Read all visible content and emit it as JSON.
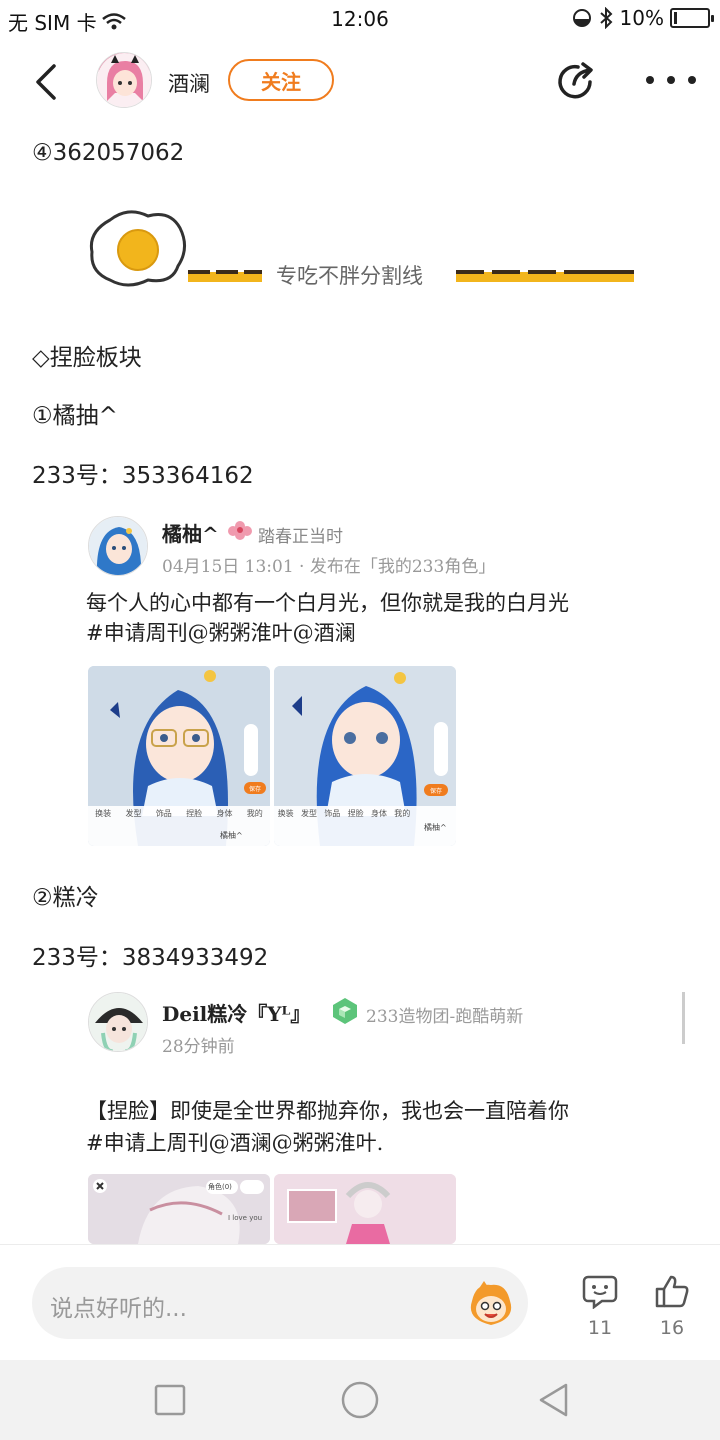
{
  "status_bar": {
    "carrier": "无 SIM 卡",
    "time": "12:06",
    "battery": "10%"
  },
  "header": {
    "author": "酒澜",
    "follow_label": "关注"
  },
  "content": {
    "qq_line": "④362057062",
    "divider_text": "专吃不胖分割线",
    "section_title": "◇捏脸板块",
    "item1_title": "①橘抽^",
    "item1_id": "233号：353364162",
    "item2_title": "②糕冷",
    "item2_id": "233号：3834933492"
  },
  "post1": {
    "name": "橘柚^",
    "motto": "踏春正当时",
    "meta": "04月15日 13:01 · 发布在「我的233角色」",
    "body_line1": "每个人的心中都有一个白月光，但你就是我的白月光",
    "body_line2": "#申请周刊@粥粥淮叶@酒澜",
    "shot_tabs": [
      "换装",
      "发型",
      "饰品",
      "捏脸",
      "身体",
      "我的"
    ],
    "shot_save": "保存",
    "shot_sign": "橘柚^"
  },
  "post2": {
    "name": "Deil糕冷『Yᴸ』",
    "group": "233造物团-跑酷萌新",
    "meta": "28分钟前",
    "body_line1": "【捏脸】即使是全世界都抛弃你，我也会一直陪着你",
    "body_line2": "#申请上周刊@酒澜@粥粥淮叶.",
    "shot_corner": "角色(0)",
    "shot_text": "I love you"
  },
  "bottom_bar": {
    "comment_placeholder": "说点好听的...",
    "comment_count": "11",
    "like_count": "16"
  },
  "colors": {
    "accent": "#f07c1e",
    "egg_yolk": "#f2b51c",
    "text_muted": "#999999"
  }
}
